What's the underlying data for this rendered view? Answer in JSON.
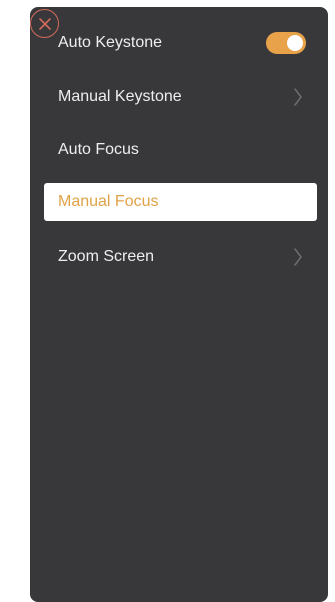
{
  "menu": {
    "items": [
      {
        "label": "Auto Keystone",
        "control": "toggle",
        "toggle_on": true
      },
      {
        "label": "Manual Keystone",
        "control": "chevron"
      },
      {
        "label": "Auto Focus",
        "control": "none"
      },
      {
        "label": "Manual Focus",
        "control": "none",
        "selected": true
      },
      {
        "label": "Zoom Screen",
        "control": "chevron"
      }
    ]
  },
  "icons": {
    "close": "close-icon",
    "chevron": "chevron-right-icon"
  },
  "colors": {
    "panel_background": "#38383b",
    "accent": "#e8a24a",
    "selected_text": "#e0a248",
    "close_ring": "#d26a5a"
  }
}
